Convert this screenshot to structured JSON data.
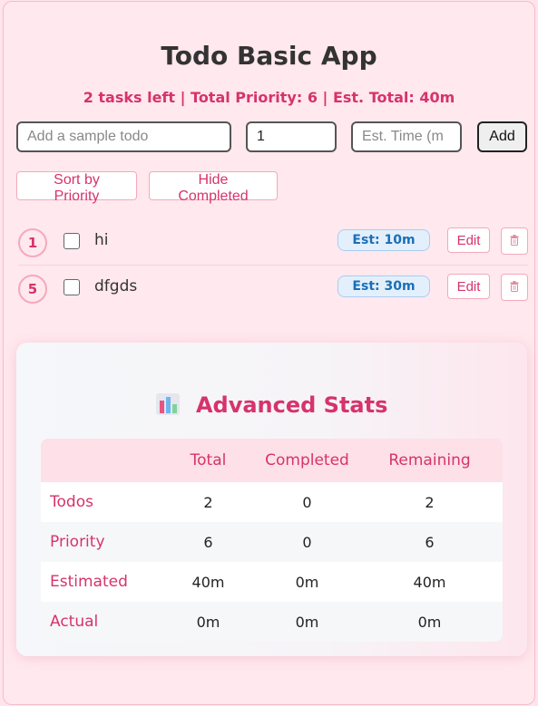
{
  "app": {
    "title": "Todo Basic App",
    "summary": "2 tasks left | Total Priority: 6 | Est. Total: 40m"
  },
  "form": {
    "text_placeholder": "Add a sample todo",
    "text_value": "",
    "priority_value": "1",
    "time_placeholder": "Est. Time (m",
    "time_value": "",
    "add_label": "Add"
  },
  "controls": {
    "sort_label": "Sort by Priority",
    "hide_label": "Hide Completed"
  },
  "todos": [
    {
      "priority": "1",
      "text": "hi",
      "est": "Est: 10m",
      "edit_label": "Edit",
      "completed": false
    },
    {
      "priority": "5",
      "text": "dfgds",
      "est": "Est: 30m",
      "edit_label": "Edit",
      "completed": false
    }
  ],
  "stats": {
    "title": "Advanced Stats",
    "icon": "bar-chart-icon",
    "columns": [
      "",
      "Total",
      "Completed",
      "Remaining"
    ],
    "rows": [
      {
        "label": "Todos",
        "total": "2",
        "completed": "0",
        "remaining": "2"
      },
      {
        "label": "Priority",
        "total": "6",
        "completed": "0",
        "remaining": "6"
      },
      {
        "label": "Estimated",
        "total": "40m",
        "completed": "0m",
        "remaining": "40m"
      },
      {
        "label": "Actual",
        "total": "0m",
        "completed": "0m",
        "remaining": "0m"
      }
    ]
  },
  "colors": {
    "accent": "#d6336c",
    "background": "#ffe8ee",
    "estimate_badge": "#e3f0fc"
  }
}
